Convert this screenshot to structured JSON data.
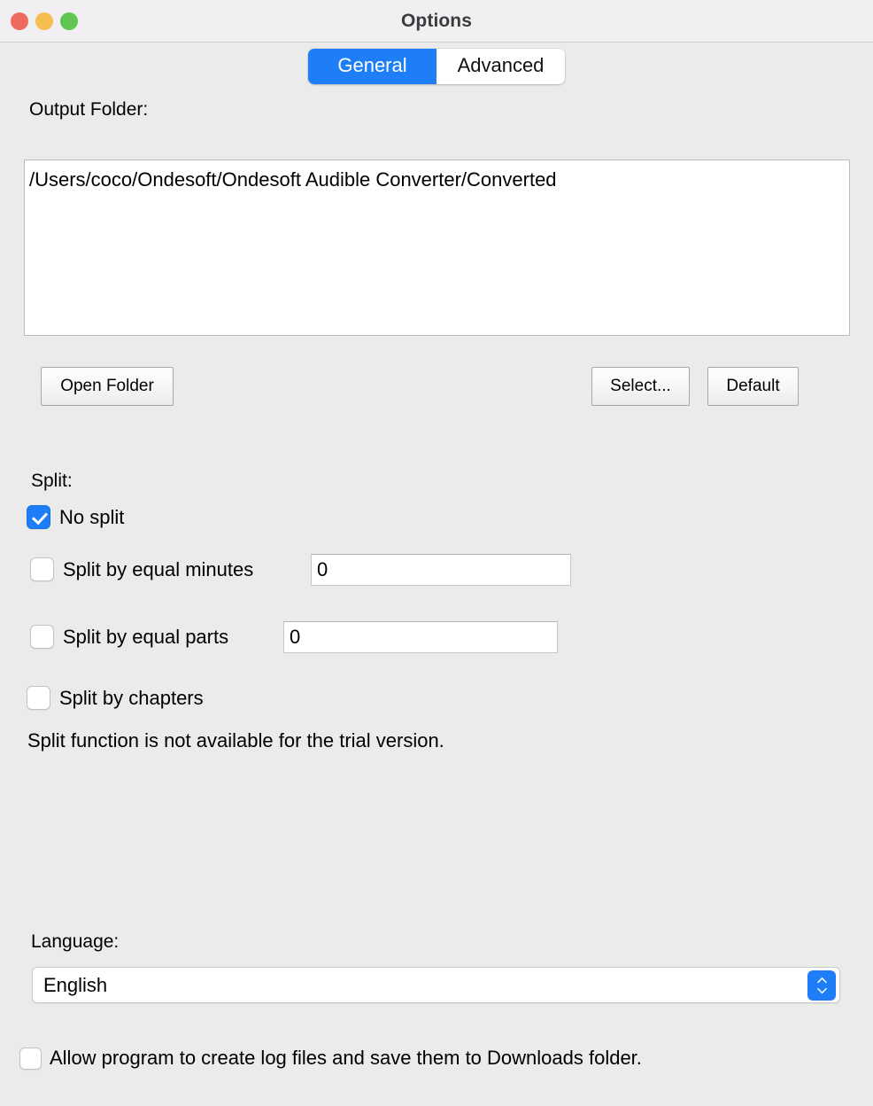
{
  "window": {
    "title": "Options",
    "traffic_lights": [
      {
        "name": "close",
        "color": "#ee6a5f"
      },
      {
        "name": "minimize",
        "color": "#f5bf4f"
      },
      {
        "name": "maximize",
        "color": "#61c554"
      }
    ]
  },
  "tabs": [
    {
      "label": "General",
      "active": true
    },
    {
      "label": "Advanced",
      "active": false
    }
  ],
  "output_folder": {
    "label": "Output Folder:",
    "path": "/Users/coco/Ondesoft/Ondesoft Audible Converter/Converted"
  },
  "buttons": {
    "open_folder": "Open Folder",
    "select": "Select...",
    "default": "Default"
  },
  "split": {
    "label": "Split:",
    "options": [
      {
        "label": "No split",
        "checked": true
      },
      {
        "label": "Split by equal minutes",
        "checked": false,
        "value": "0"
      },
      {
        "label": "Split by equal parts",
        "checked": false,
        "value": "0"
      },
      {
        "label": "Split by chapters",
        "checked": false
      }
    ],
    "note": "Split function is not available for the trial version."
  },
  "language": {
    "label": "Language:",
    "selected": "English"
  },
  "logging": {
    "label": "Allow program to create log files and save them to Downloads folder.",
    "checked": false
  },
  "colors": {
    "accent": "#1d7ef8",
    "titlebar": "#f2eff3",
    "window_background": "#ebebeb"
  }
}
